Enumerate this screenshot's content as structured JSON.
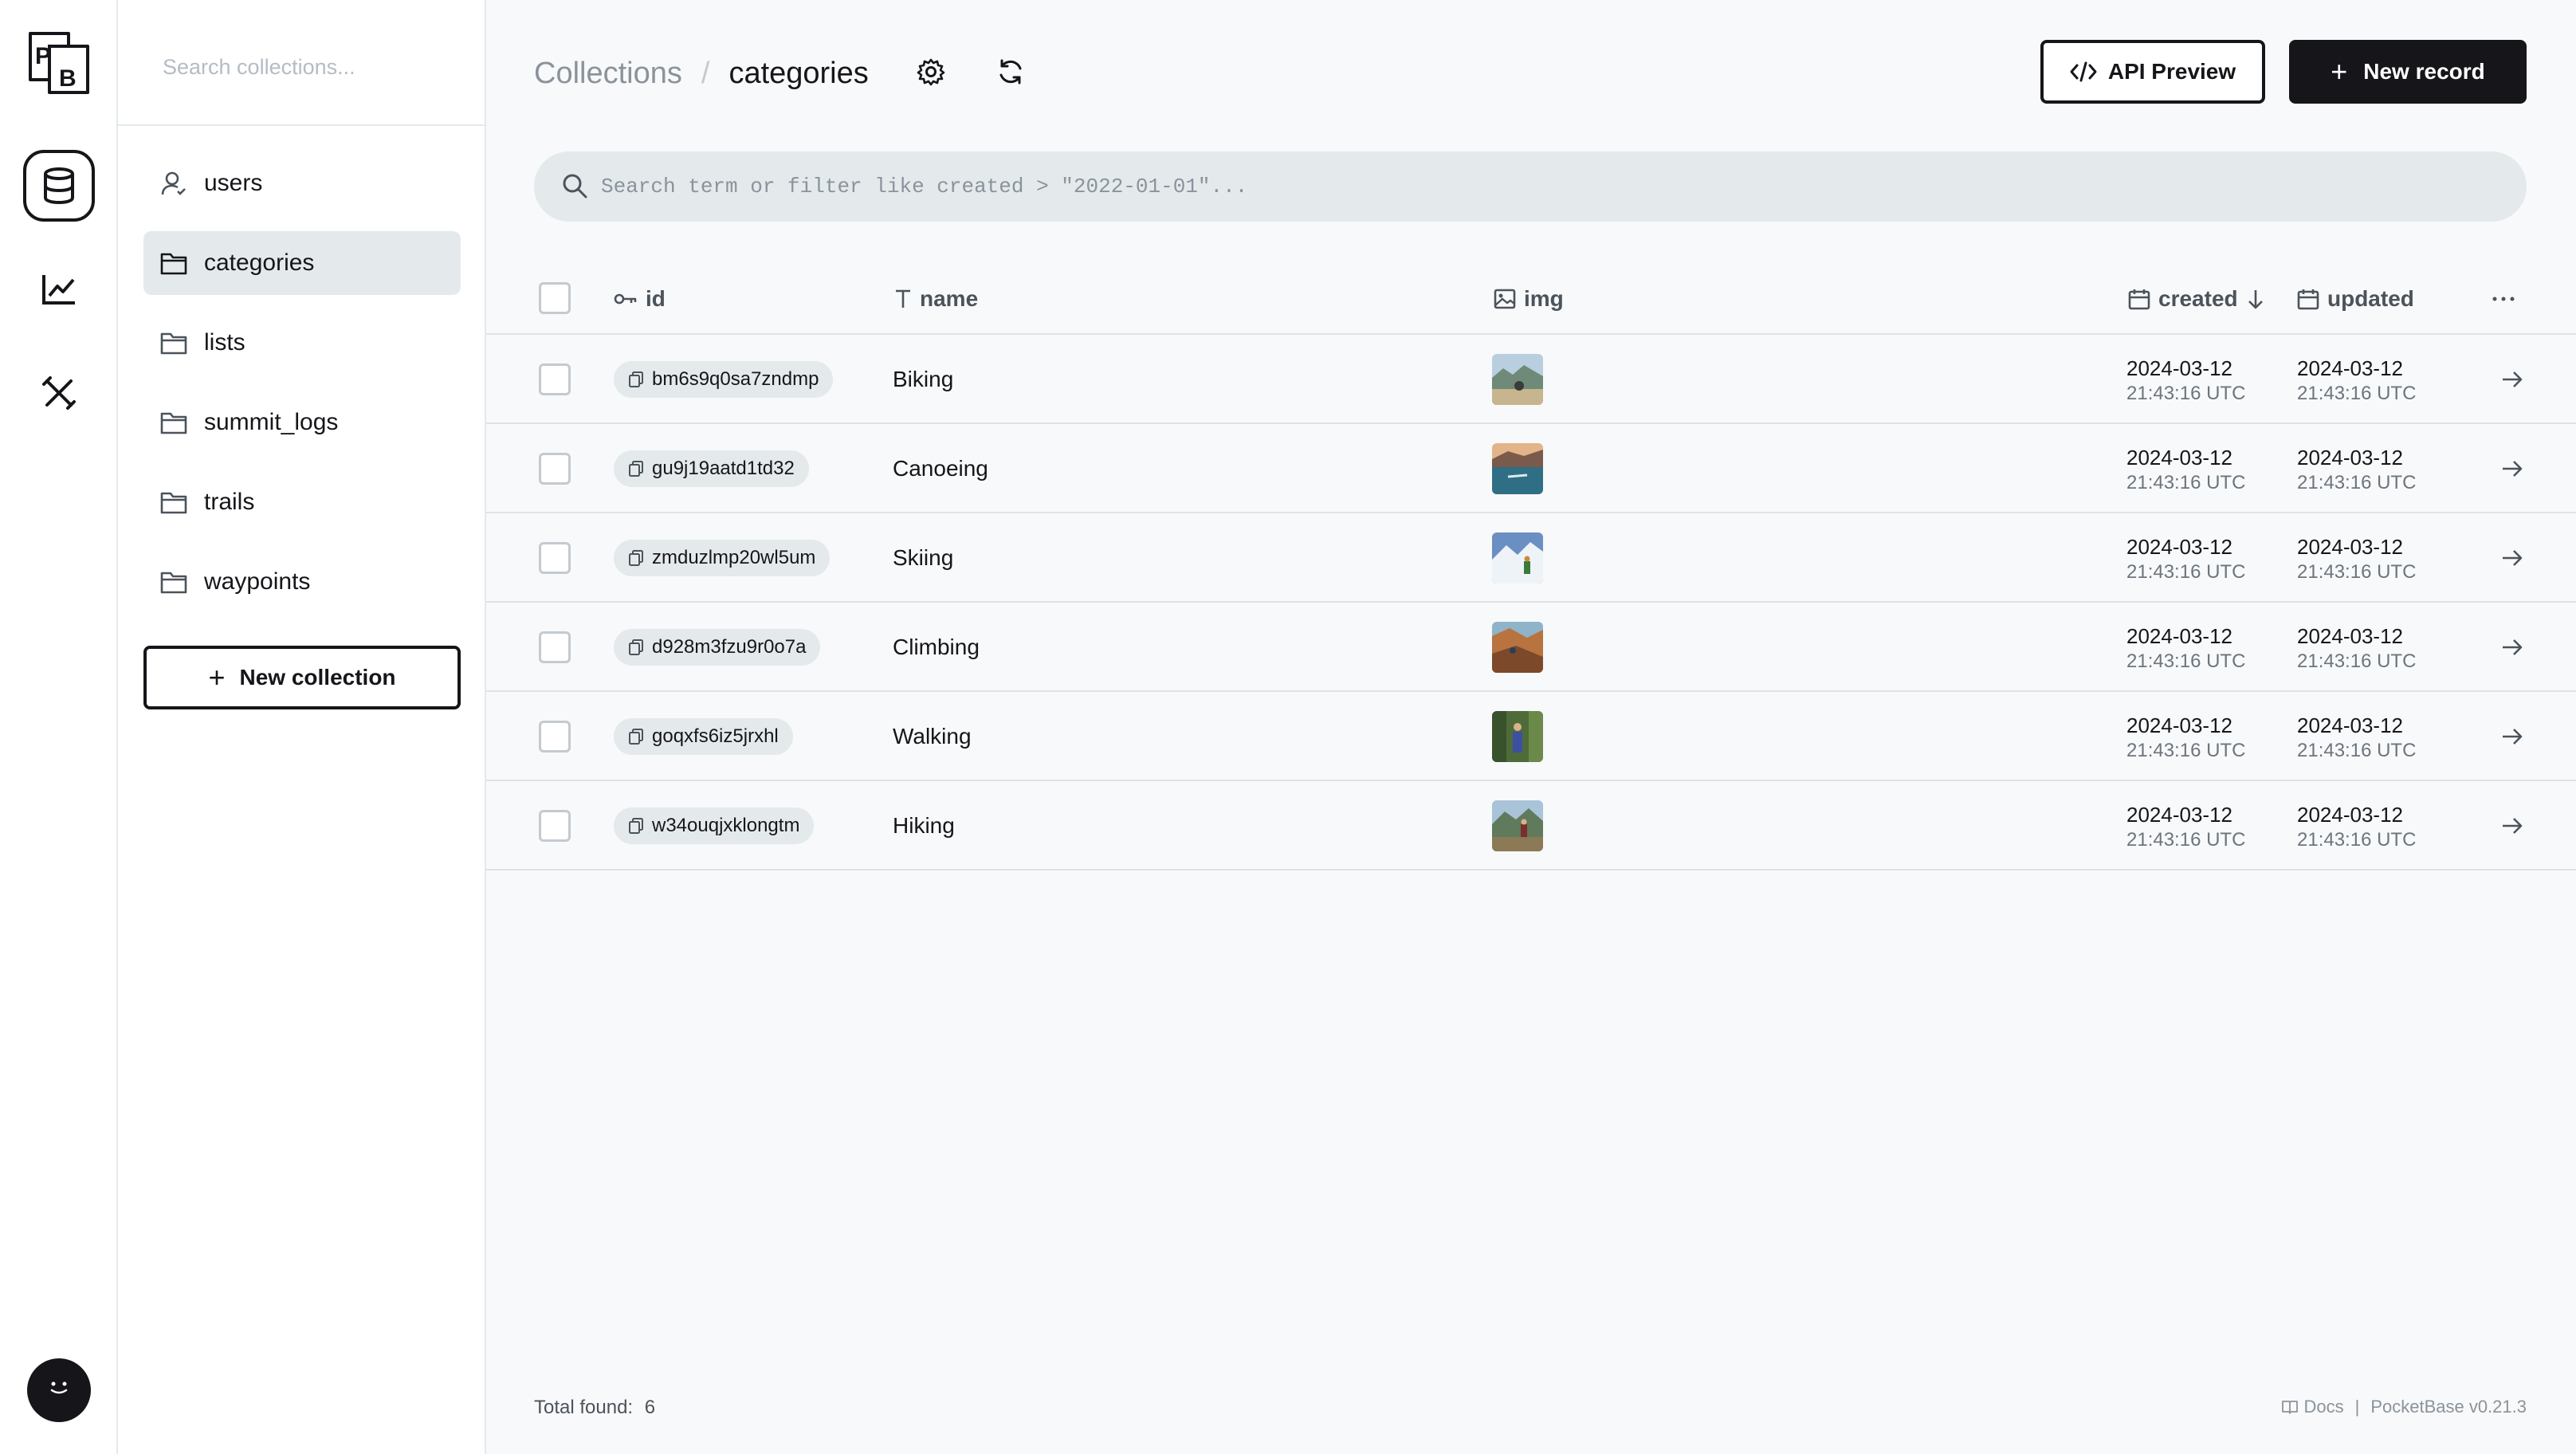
{
  "rail": {
    "logo_text": "PB",
    "items": [
      {
        "name": "collections",
        "icon": "database-icon",
        "active": true
      },
      {
        "name": "logs",
        "icon": "chart-line-icon",
        "active": false
      },
      {
        "name": "settings",
        "icon": "tools-icon",
        "active": false
      }
    ]
  },
  "sidebar": {
    "search_placeholder": "Search collections...",
    "items": [
      {
        "label": "users",
        "icon": "user-icon",
        "active": false
      },
      {
        "label": "categories",
        "icon": "folder-icon",
        "active": true
      },
      {
        "label": "lists",
        "icon": "folder-icon",
        "active": false
      },
      {
        "label": "summit_logs",
        "icon": "folder-icon",
        "active": false
      },
      {
        "label": "trails",
        "icon": "folder-icon",
        "active": false
      },
      {
        "label": "waypoints",
        "icon": "folder-icon",
        "active": false
      }
    ],
    "new_collection_label": "New collection"
  },
  "header": {
    "breadcrumb_parent": "Collections",
    "breadcrumb_separator": "/",
    "breadcrumb_current": "categories",
    "api_preview_label": "API Preview",
    "new_record_label": "New record"
  },
  "filter": {
    "placeholder": "Search term or filter like created > \"2022-01-01\"..."
  },
  "table": {
    "columns": {
      "id": "id",
      "name": "name",
      "img": "img",
      "created": "created",
      "updated": "updated"
    },
    "rows": [
      {
        "id": "bm6s9q0sa7zndmp",
        "name": "Biking",
        "created_date": "2024-03-12",
        "created_time": "21:43:16 UTC",
        "updated_date": "2024-03-12",
        "updated_time": "21:43:16 UTC"
      },
      {
        "id": "gu9j19aatd1td32",
        "name": "Canoeing",
        "created_date": "2024-03-12",
        "created_time": "21:43:16 UTC",
        "updated_date": "2024-03-12",
        "updated_time": "21:43:16 UTC"
      },
      {
        "id": "zmduzlmp20wl5um",
        "name": "Skiing",
        "created_date": "2024-03-12",
        "created_time": "21:43:16 UTC",
        "updated_date": "2024-03-12",
        "updated_time": "21:43:16 UTC"
      },
      {
        "id": "d928m3fzu9r0o7a",
        "name": "Climbing",
        "created_date": "2024-03-12",
        "created_time": "21:43:16 UTC",
        "updated_date": "2024-03-12",
        "updated_time": "21:43:16 UTC"
      },
      {
        "id": "goqxfs6iz5jrxhl",
        "name": "Walking",
        "created_date": "2024-03-12",
        "created_time": "21:43:16 UTC",
        "updated_date": "2024-03-12",
        "updated_time": "21:43:16 UTC"
      },
      {
        "id": "w34ouqjxklongtm",
        "name": "Hiking",
        "created_date": "2024-03-12",
        "created_time": "21:43:16 UTC",
        "updated_date": "2024-03-12",
        "updated_time": "21:43:16 UTC"
      }
    ]
  },
  "footer": {
    "total_label": "Total found:",
    "total_count": "6",
    "docs_label": "Docs",
    "separator": "|",
    "version": "PocketBase v0.21.3"
  }
}
